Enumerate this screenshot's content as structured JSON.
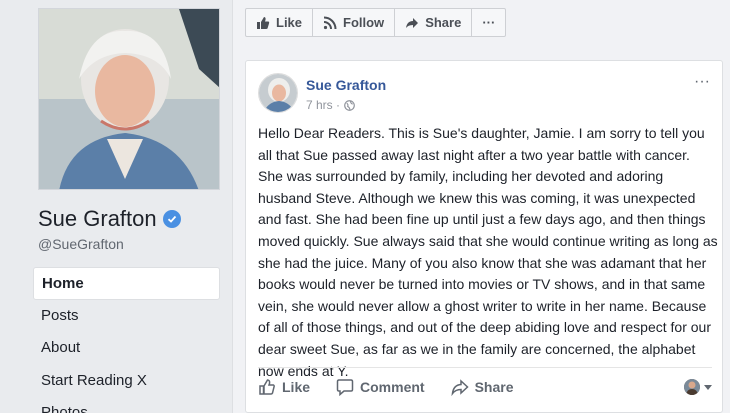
{
  "page": {
    "name": "Sue Grafton",
    "handle": "@SueGrafton"
  },
  "nav": {
    "items": [
      {
        "label": "Home",
        "active": true
      },
      {
        "label": "Posts",
        "active": false
      },
      {
        "label": "About",
        "active": false
      },
      {
        "label": "Start Reading X",
        "active": false
      },
      {
        "label": "Photos",
        "active": false
      }
    ]
  },
  "toolbar": {
    "like_label": "Like",
    "follow_label": "Follow",
    "share_label": "Share",
    "more_label": "···"
  },
  "post": {
    "author": "Sue Grafton",
    "time": "7 hrs",
    "separator": "·",
    "more_label": "···",
    "text": "Hello Dear Readers. This is Sue's daughter, Jamie. I am sorry to tell you all that Sue passed away last night after a two year battle with cancer. She was surrounded by family, including her devoted and adoring husband Steve. Although we knew this was coming, it was unexpected and fast. She had been fine up until just a few days ago, and then things moved quickly. Sue always said that she would continue writing as long as she had the juice. Many of you also know that she was adamant that her books would never be turned into movies or TV shows, and in that same vein, she would never allow a ghost writer to write in her name. Because of all of those things, and out of the deep abiding love and respect for our dear sweet Sue, as far as we in the family are concerned, the alphabet now ends at Y.",
    "actions": {
      "like_label": "Like",
      "comment_label": "Comment",
      "share_label": "Share"
    }
  },
  "colors": {
    "link": "#365899",
    "verified": "#4a90e2",
    "background": "#e9ebee"
  }
}
